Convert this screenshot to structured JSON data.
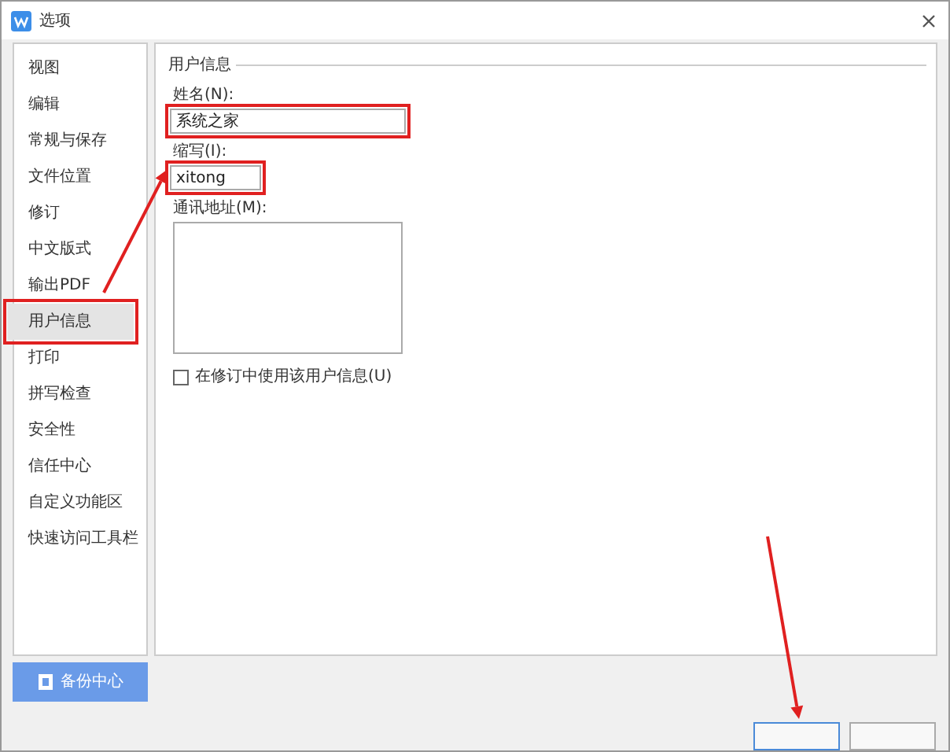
{
  "window": {
    "title": "选项"
  },
  "sidebar": {
    "items": [
      {
        "label": "视图",
        "selected": false,
        "highlighted": false
      },
      {
        "label": "编辑",
        "selected": false,
        "highlighted": false
      },
      {
        "label": "常规与保存",
        "selected": false,
        "highlighted": false
      },
      {
        "label": "文件位置",
        "selected": false,
        "highlighted": false
      },
      {
        "label": "修订",
        "selected": false,
        "highlighted": false
      },
      {
        "label": "中文版式",
        "selected": false,
        "highlighted": false
      },
      {
        "label": "输出PDF",
        "selected": false,
        "highlighted": false
      },
      {
        "label": "用户信息",
        "selected": true,
        "highlighted": true
      },
      {
        "label": "打印",
        "selected": false,
        "highlighted": false
      },
      {
        "label": "拼写检查",
        "selected": false,
        "highlighted": false
      },
      {
        "label": "安全性",
        "selected": false,
        "highlighted": false
      },
      {
        "label": "信任中心",
        "selected": false,
        "highlighted": false
      },
      {
        "label": "自定义功能区",
        "selected": false,
        "highlighted": false
      },
      {
        "label": "快速访问工具栏",
        "selected": false,
        "highlighted": false
      }
    ]
  },
  "panel": {
    "group_title": "用户信息",
    "fields": [
      {
        "kind": "wide_input",
        "label": "姓名(N):",
        "value": "系统之家",
        "highlighted": true
      },
      {
        "kind": "short_input",
        "label": "缩写(I):",
        "value": "xitong",
        "highlighted": true
      },
      {
        "kind": "textarea",
        "label": "通讯地址(M):",
        "highlighted": false
      }
    ],
    "checkbox": {
      "label": "在修订中使用该用户信息(U)",
      "checked": false
    }
  },
  "backup_button": "备份中心",
  "footer_buttons": [
    {
      "kind": "primary"
    },
    {
      "kind": "secondary"
    }
  ]
}
